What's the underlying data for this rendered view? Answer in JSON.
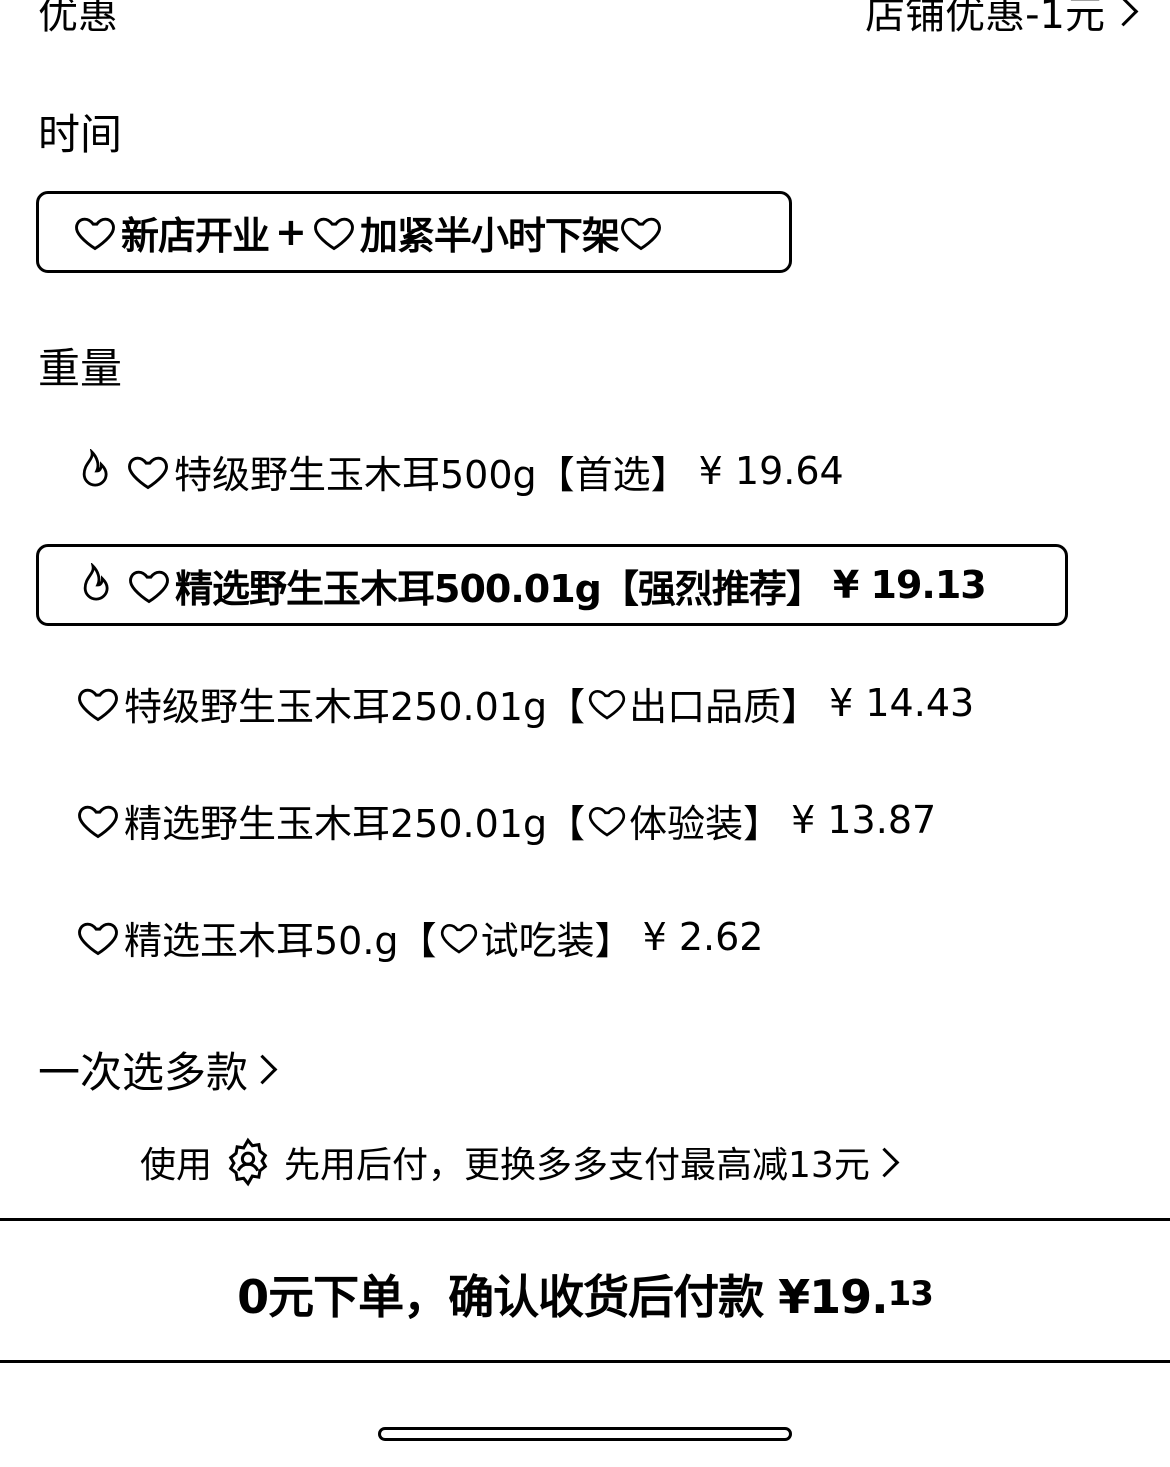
{
  "coupon": {
    "label": "优惠",
    "value": "店铺优惠-1元"
  },
  "time_section": {
    "label": "时间",
    "option_part1": "新店开业",
    "option_plus": "+",
    "option_part2": "加紧半小时下架"
  },
  "weight_section": {
    "label": "重量",
    "options": [
      {
        "name": "特级野生玉木耳500g",
        "tag": "【首选】",
        "price": "¥ 19.64",
        "flame": true,
        "tag_heart": false,
        "selected": false
      },
      {
        "name": "精选野生玉木耳500.01g",
        "tag": "【强烈推荐】",
        "price": "¥ 19.13",
        "flame": true,
        "tag_heart": false,
        "selected": true
      },
      {
        "name": "特级野生玉木耳250.01g",
        "tag_open": "【",
        "tag": "出口品质】",
        "price": "¥ 14.43",
        "flame": false,
        "tag_heart": true,
        "selected": false
      },
      {
        "name": "精选野生玉木耳250.01g",
        "tag_open": "【",
        "tag": "体验装】",
        "price": "¥ 13.87",
        "flame": false,
        "tag_heart": true,
        "selected": false
      },
      {
        "name": "精选玉木耳50.g",
        "tag_open": "【",
        "tag": "试吃装】",
        "price": "¥ 2.62",
        "flame": false,
        "tag_heart": true,
        "selected": false
      }
    ]
  },
  "multi_select": {
    "label": "一次选多款"
  },
  "pay_bar": {
    "prefix": "使用",
    "text": "先用后付，更换多多支付最高减13元",
    "icon": "shield-icon"
  },
  "cta": {
    "main": "0元下单，确认收货后付款 ¥19.",
    "cents": "13"
  }
}
